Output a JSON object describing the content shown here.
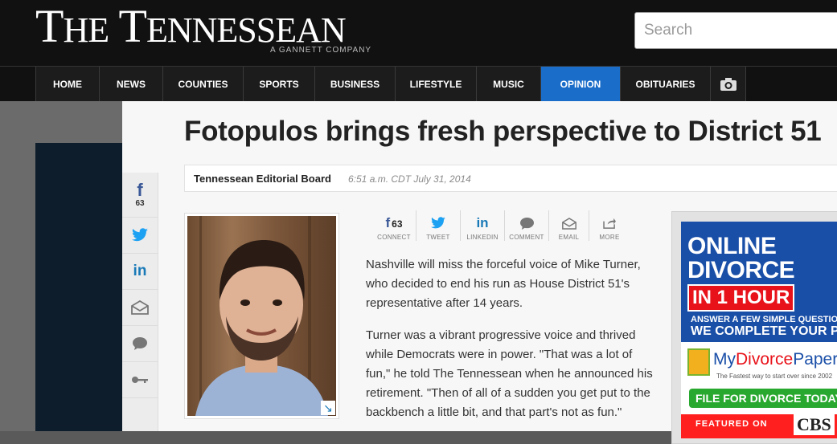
{
  "masthead": {
    "logo_first": "T",
    "logo_first_rest": "HE",
    "logo_second": "T",
    "logo_second_rest": "ENNESSEAN",
    "tagline": "A GANNETT COMPANY",
    "search_placeholder": "Search"
  },
  "nav": {
    "items": [
      {
        "label": "HOME"
      },
      {
        "label": "NEWS"
      },
      {
        "label": "COUNTIES"
      },
      {
        "label": "SPORTS"
      },
      {
        "label": "BUSINESS"
      },
      {
        "label": "LIFESTYLE"
      },
      {
        "label": "MUSIC"
      },
      {
        "label": "OPINION"
      },
      {
        "label": "OBITUARIES"
      }
    ],
    "active": "OPINION",
    "active_color": "#1a6dc9"
  },
  "sidebar_share": {
    "facebook_count": "63"
  },
  "article": {
    "headline": "Fotopulos brings fresh perspective to District 51",
    "author": "Tennessean Editorial Board",
    "timestamp": "6:51 a.m. CDT July 31, 2014",
    "share_row": {
      "facebook_count": "63",
      "labels": [
        "CONNECT",
        "TWEET",
        "LINKEDIN",
        "COMMENT",
        "EMAIL",
        "MORE"
      ]
    },
    "paragraphs": [
      "Nashville will miss the forceful voice of Mike Turner, who decided to end his run as House District 51's representative after 14 years.",
      "Turner was a vibrant progressive voice and thrived while Democrats were in power. \"That was a lot of fun,\" he told The Tennessean when he announced his retirement. \"Then of all of a sudden you get put to the backbench a little bit, and that part's not as fun.\""
    ]
  },
  "ad": {
    "line1": "ONLINE",
    "line2": "DIVORCE",
    "line3": "IN 1 HOUR",
    "sub1": "ANSWER A FEW SIMPLE QUESTIO",
    "sub2": "WE COMPLETE YOUR PA",
    "brand_my": "My",
    "brand_divorce": "Divorce",
    "brand_papers": "Papers",
    "tag": "The Fastest way to start over since 2002",
    "button": "FILE FOR DIVORCE TODAY",
    "featured": "FEATURED ON",
    "cbs": "CBS"
  }
}
